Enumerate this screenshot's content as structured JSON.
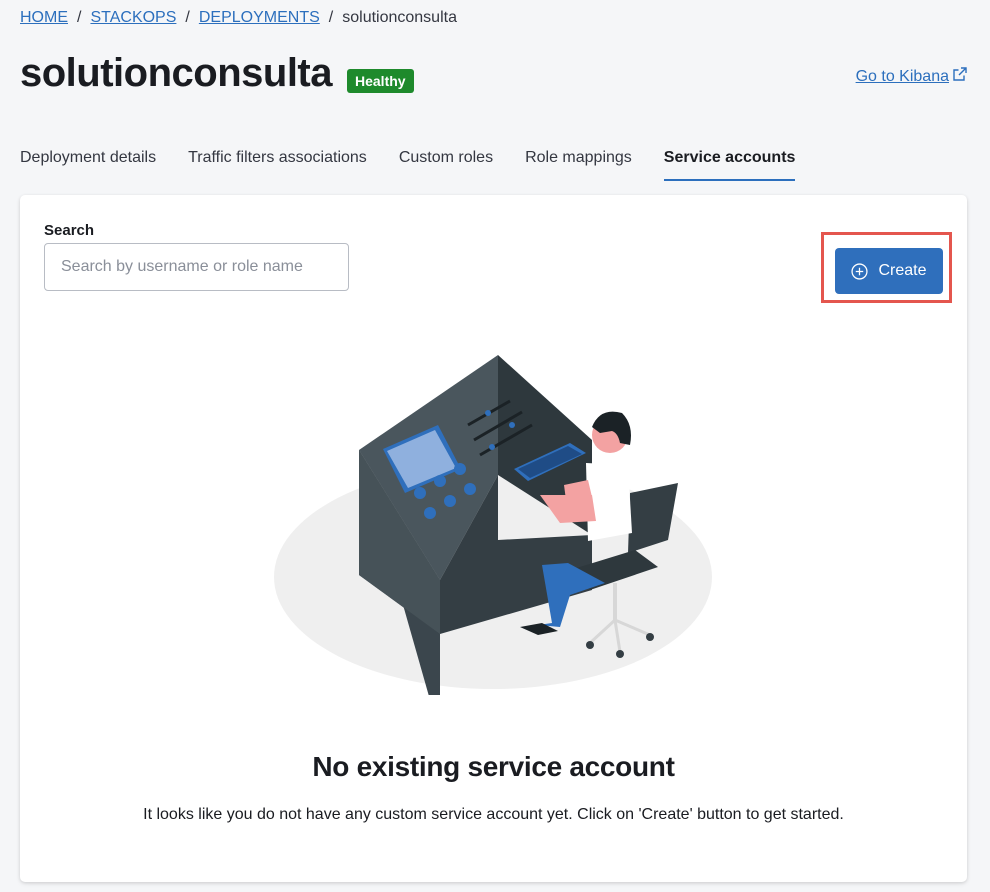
{
  "breadcrumb": {
    "items": [
      "HOME",
      "STACKOPS",
      "DEPLOYMENTS"
    ],
    "separator": "/",
    "current": "solutionconsulta"
  },
  "page": {
    "title": "solutionconsulta",
    "status_badge": "Healthy",
    "kibana_link": "Go to Kibana"
  },
  "tabs": [
    {
      "label": "Deployment details",
      "active": false
    },
    {
      "label": "Traffic filters associations",
      "active": false
    },
    {
      "label": "Custom roles",
      "active": false
    },
    {
      "label": "Role mappings",
      "active": false
    },
    {
      "label": "Service accounts",
      "active": true
    }
  ],
  "search": {
    "label": "Search",
    "placeholder": "Search by username or role name",
    "value": ""
  },
  "create_button": {
    "label": "Create",
    "icon": "plus-circle-icon"
  },
  "empty_state": {
    "title": "No existing service account",
    "description": "It looks like you do not have any custom service account yet. Click on 'Create' button to get started."
  },
  "colors": {
    "accent": "#2f6fbc",
    "link": "#2c6fbd",
    "healthy": "#1e8a2c",
    "highlight": "#e4564e",
    "background": "#f5f6f8"
  }
}
